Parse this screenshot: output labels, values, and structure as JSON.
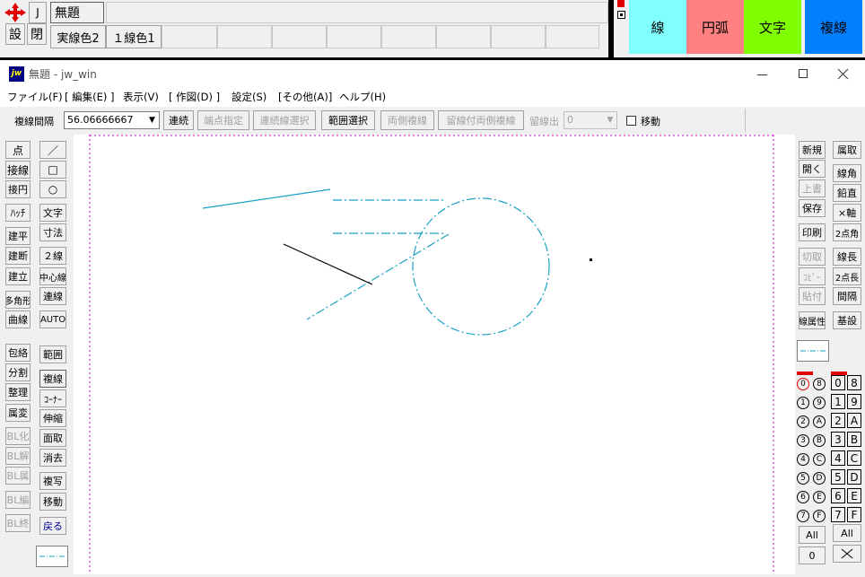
{
  "top": {
    "jshape": "J",
    "settings": "設",
    "close": "閉",
    "layer_name": "無題",
    "line_color": "実線色2",
    "line_width": "１線色1",
    "color_buttons": [
      {
        "label": "線",
        "color": "#80ffff"
      },
      {
        "label": "円弧",
        "color": "#ff8080"
      },
      {
        "label": "文字",
        "color": "#80ff00"
      },
      {
        "label": "複線",
        "color": "#0080ff"
      }
    ]
  },
  "window": {
    "app_icon": "jw",
    "title": "無題 - jw_win",
    "menu": [
      "ファイル(F)",
      "[ 編集(E) ]",
      "表示(V)",
      "[ 作図(D) ]",
      "設定(S)",
      "[その他(A)]",
      "ヘルプ(H)"
    ]
  },
  "toolbar": {
    "label": "複線間隔",
    "value": "56.06666667",
    "buttons": [
      {
        "label": "連続",
        "enabled": true
      },
      {
        "label": "端点指定",
        "enabled": false
      },
      {
        "label": "連続線選択",
        "enabled": false
      },
      {
        "label": "範囲選択",
        "enabled": true
      },
      {
        "label": "両側複線",
        "enabled": false
      },
      {
        "label": "留線付両側複線",
        "enabled": false
      }
    ],
    "tome_label": "留線出",
    "tome_value": "0",
    "move_label": "移動"
  },
  "left_tools": [
    [
      "点",
      "／"
    ],
    [
      "接線",
      "□"
    ],
    [
      "接円",
      "○"
    ],
    [
      "ﾊｯﾁ",
      "文字"
    ],
    [
      "建平",
      "寸法"
    ],
    [
      "建断",
      "２線"
    ],
    [
      "建立",
      "中心線"
    ],
    [
      "多角形",
      "連線"
    ],
    [
      "曲線",
      "AUTO"
    ],
    [
      "包絡",
      "範囲"
    ],
    [
      "分割",
      "複線"
    ],
    [
      "整理",
      "ｺｰﾅｰ"
    ],
    [
      "属変",
      "伸縮"
    ],
    [
      "BL化",
      "面取"
    ],
    [
      "BL解",
      "消去"
    ],
    [
      "BL属",
      "複写"
    ],
    [
      "BL編",
      "移動"
    ],
    [
      "BL終",
      "戻る"
    ]
  ],
  "right_tools_a": [
    "新規",
    "開く",
    "上書",
    "保存",
    "印刷",
    "切取",
    "ｺﾋﾟｰ",
    "貼付",
    "線属性"
  ],
  "right_tools_b": [
    "属取",
    "線角",
    "鉛直",
    "×軸",
    "2点角",
    "線長",
    "2点長",
    "間隔",
    "基設"
  ],
  "layer_groups": [
    "0",
    "1",
    "2",
    "3",
    "4",
    "5",
    "6",
    "7"
  ],
  "layer_groups_b": [
    "8",
    "9",
    "A",
    "B",
    "C",
    "D",
    "E",
    "F"
  ],
  "all_label": "All",
  "zero_label": "0"
}
